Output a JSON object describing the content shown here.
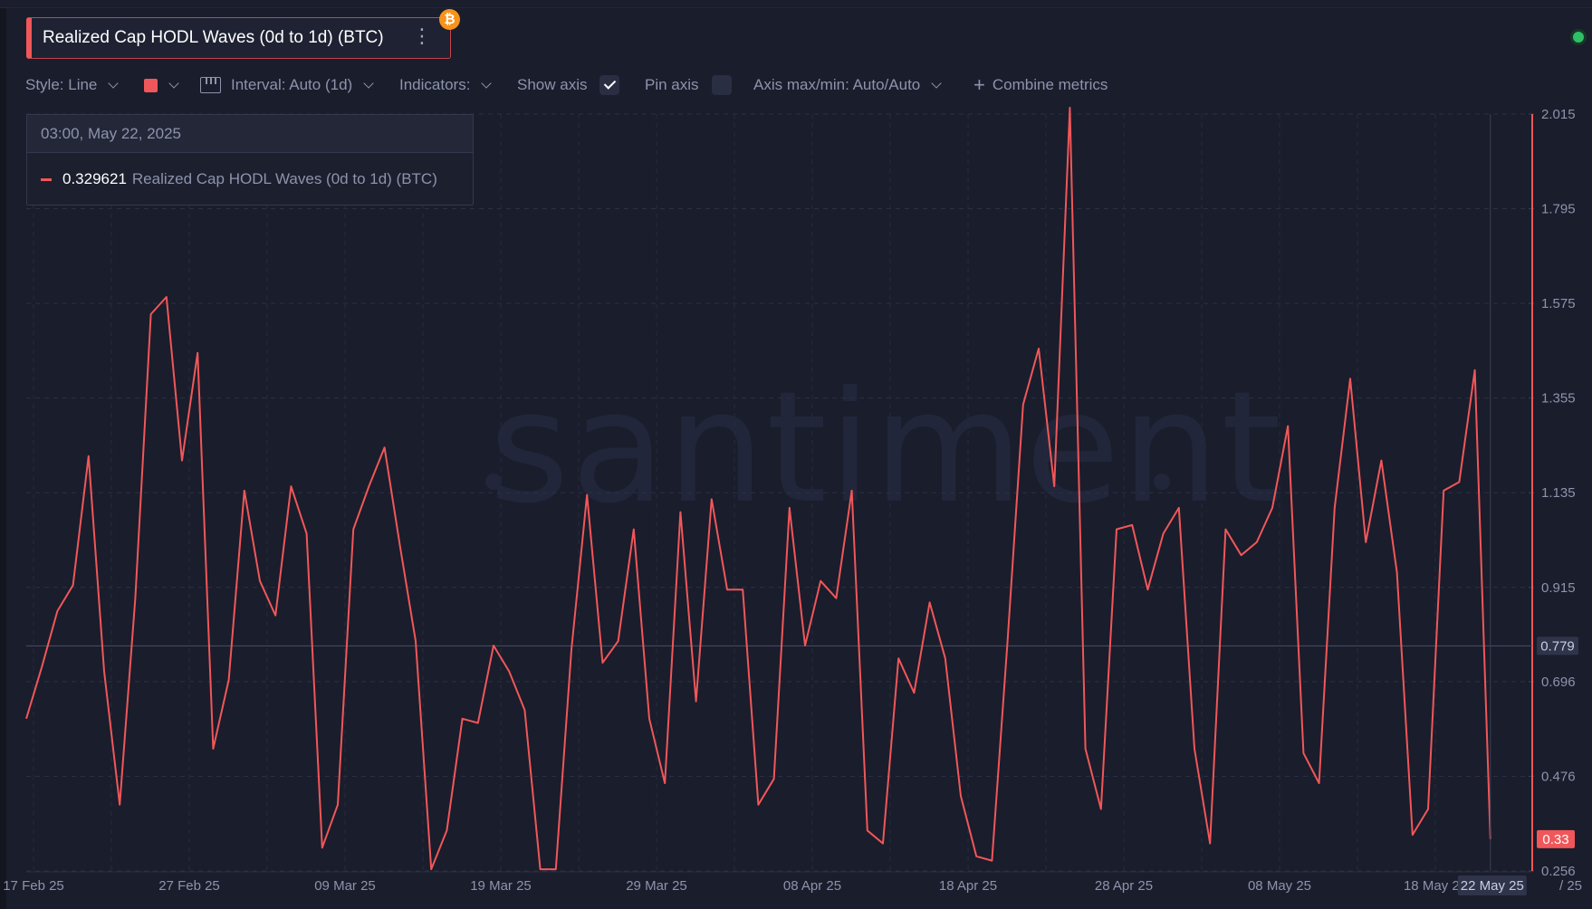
{
  "header": {
    "metric_title": "Realized Cap HODL Waves (0d to 1d) (BTC)",
    "more_icon": "vertical-dots-icon",
    "asset_badge": "₿",
    "status_color": "#2fbf68"
  },
  "toolbar": {
    "style_label": "Style: Line",
    "color_swatch": "#f0575a",
    "interval_label": "Interval: Auto (1d)",
    "indicators_label": "Indicators:",
    "show_axis_label": "Show axis",
    "show_axis_checked": true,
    "pin_axis_label": "Pin axis",
    "pin_axis_checked": false,
    "axis_maxmin_label": "Axis max/min: Auto/Auto",
    "combine_label": "Combine metrics"
  },
  "tooltip": {
    "date": "03:00, May 22, 2025",
    "value": "0.329621",
    "series_name": "Realized Cap HODL Waves (0d to 1d) (BTC)"
  },
  "watermark": "santiment",
  "chart_data": {
    "type": "line",
    "series_color": "#f0575a",
    "ylim": [
      0.256,
      2.015
    ],
    "y_ticks": [
      "2.015",
      "1.795",
      "1.575",
      "1.355",
      "1.135",
      "0.915",
      "0.696",
      "0.476",
      "0.256"
    ],
    "x_ticks": [
      "17 Feb 25",
      "27 Feb 25",
      "09 Mar 25",
      "19 Mar 25",
      "29 Mar 25",
      "08 Apr 25",
      "18 Apr 25",
      "28 Apr 25",
      "08 May 25",
      "18 May 25"
    ],
    "x_tick_partial": "/ 25",
    "crosshair_label": "22 May 25",
    "hover_y_value": 0.779,
    "hover_y_label": "0.779",
    "last_value_label": "0.33",
    "x_start": "2025-02-17",
    "series": [
      {
        "dates": [
          "2025-02-17",
          "2025-02-18",
          "2025-02-19",
          "2025-02-20",
          "2025-02-21",
          "2025-02-22",
          "2025-02-23",
          "2025-02-24",
          "2025-02-25",
          "2025-02-26",
          "2025-02-27",
          "2025-02-28",
          "2025-03-01",
          "2025-03-02",
          "2025-03-03",
          "2025-03-04",
          "2025-03-05",
          "2025-03-06",
          "2025-03-07",
          "2025-03-08",
          "2025-03-09",
          "2025-03-10",
          "2025-03-11",
          "2025-03-12",
          "2025-03-13",
          "2025-03-14",
          "2025-03-15",
          "2025-03-16",
          "2025-03-17",
          "2025-03-18",
          "2025-03-19",
          "2025-03-20",
          "2025-03-21",
          "2025-03-22",
          "2025-03-23",
          "2025-03-24",
          "2025-03-25",
          "2025-03-26",
          "2025-03-27",
          "2025-03-28",
          "2025-03-29",
          "2025-03-30",
          "2025-03-31",
          "2025-04-01",
          "2025-04-02",
          "2025-04-03",
          "2025-04-04",
          "2025-04-05",
          "2025-04-06",
          "2025-04-07",
          "2025-04-08",
          "2025-04-09",
          "2025-04-10",
          "2025-04-11",
          "2025-04-12",
          "2025-04-13",
          "2025-04-14",
          "2025-04-15",
          "2025-04-16",
          "2025-04-17",
          "2025-04-18",
          "2025-04-19",
          "2025-04-20",
          "2025-04-21",
          "2025-04-22",
          "2025-04-23",
          "2025-04-24",
          "2025-04-25",
          "2025-04-26",
          "2025-04-27",
          "2025-04-28",
          "2025-04-29",
          "2025-04-30",
          "2025-05-01",
          "2025-05-02",
          "2025-05-03",
          "2025-05-04",
          "2025-05-05",
          "2025-05-06",
          "2025-05-07",
          "2025-05-08",
          "2025-05-09",
          "2025-05-10",
          "2025-05-11",
          "2025-05-12",
          "2025-05-13",
          "2025-05-14",
          "2025-05-15",
          "2025-05-16",
          "2025-05-17",
          "2025-05-18",
          "2025-05-19",
          "2025-05-20",
          "2025-05-21",
          "2025-05-22"
        ],
        "values": [
          0.61,
          0.73,
          0.86,
          0.92,
          1.22,
          0.72,
          0.41,
          0.89,
          1.55,
          1.59,
          1.21,
          1.46,
          0.54,
          0.7,
          1.14,
          0.93,
          0.85,
          1.15,
          1.04,
          0.31,
          0.41,
          1.05,
          1.15,
          1.24,
          1.01,
          0.79,
          0.26,
          0.35,
          0.61,
          0.6,
          0.78,
          0.72,
          0.63,
          0.26,
          0.26,
          0.77,
          1.13,
          0.74,
          0.79,
          1.05,
          0.61,
          0.46,
          1.09,
          0.65,
          1.12,
          0.91,
          0.91,
          0.41,
          0.47,
          1.1,
          0.78,
          0.93,
          0.89,
          1.14,
          0.35,
          0.32,
          0.75,
          0.67,
          0.88,
          0.75,
          0.43,
          0.29,
          0.28,
          0.79,
          1.34,
          1.47,
          1.15,
          2.03,
          0.54,
          0.4,
          1.05,
          1.06,
          0.91,
          1.04,
          1.1,
          0.54,
          0.32,
          1.05,
          0.99,
          1.02,
          1.1,
          1.29,
          0.53,
          0.46,
          1.1,
          1.4,
          1.02,
          1.21,
          0.95,
          0.34,
          0.4,
          1.14,
          1.16,
          1.42,
          0.33
        ]
      }
    ]
  }
}
